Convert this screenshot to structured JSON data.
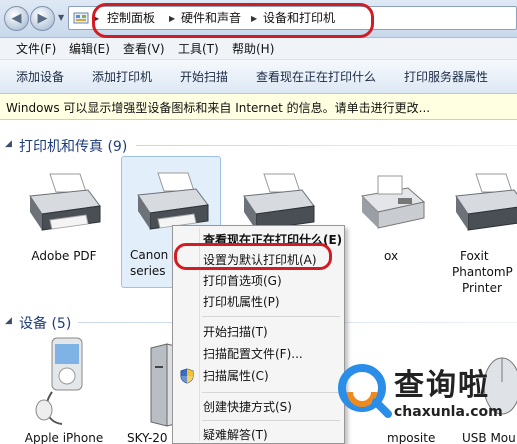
{
  "address_bar": {
    "breadcrumbs": [
      "控制面板",
      "硬件和声音",
      "设备和打印机"
    ],
    "highlight_color": "#d21c23"
  },
  "menu_bar": {
    "items": [
      "文件(F)",
      "编辑(E)",
      "查看(V)",
      "工具(T)",
      "帮助(H)"
    ]
  },
  "toolbar": {
    "buttons": [
      "添加设备",
      "添加打印机",
      "开始扫描",
      "查看现在正在打印什么",
      "打印服务器属性"
    ]
  },
  "info_bar": {
    "text": "Windows 可以显示增强型设备图标和来自 Internet 的信息。请单击进行更改..."
  },
  "printers_group": {
    "title": "打印机和传真 (9)",
    "items": [
      {
        "label": "Adobe PDF",
        "icon": "printer-icon"
      },
      {
        "label": "Canon",
        "label2": "series",
        "icon": "printer-icon",
        "selected": true
      },
      {
        "label": "",
        "icon": "printer-icon"
      },
      {
        "label": "ox",
        "icon": "fax-icon"
      },
      {
        "label": "Foxit",
        "label2": "PhantomP",
        "label3": "Printer",
        "icon": "printer-icon"
      }
    ]
  },
  "devices_group": {
    "title": "设备 (5)",
    "items": [
      {
        "label": "Apple iPhone",
        "icon": "iphone-icon"
      },
      {
        "label": "SKY-20",
        "icon": "computer-tower-icon"
      },
      {
        "label": "mposite",
        "icon": "device-icon"
      },
      {
        "label": "USB Mou",
        "icon": "mouse-icon"
      }
    ]
  },
  "context_menu": {
    "items": [
      {
        "label": "查看现在正在打印什么(E)",
        "bold": true
      },
      {
        "label": "设置为默认打印机(A)",
        "highlighted": true
      },
      {
        "label": "打印首选项(G)"
      },
      {
        "label": "打印机属性(P)"
      },
      {
        "label": "开始扫描(T)"
      },
      {
        "label": "扫描配置文件(F)..."
      },
      {
        "label": "扫描属性(C)",
        "icon": "uac-shield-icon"
      },
      {
        "label": "创建快捷方式(S)"
      },
      {
        "label": "疑难解答(T)"
      }
    ]
  },
  "watermark": {
    "text": "查询啦",
    "sub": "chaxunla.com",
    "color": "#2a8ee8"
  }
}
